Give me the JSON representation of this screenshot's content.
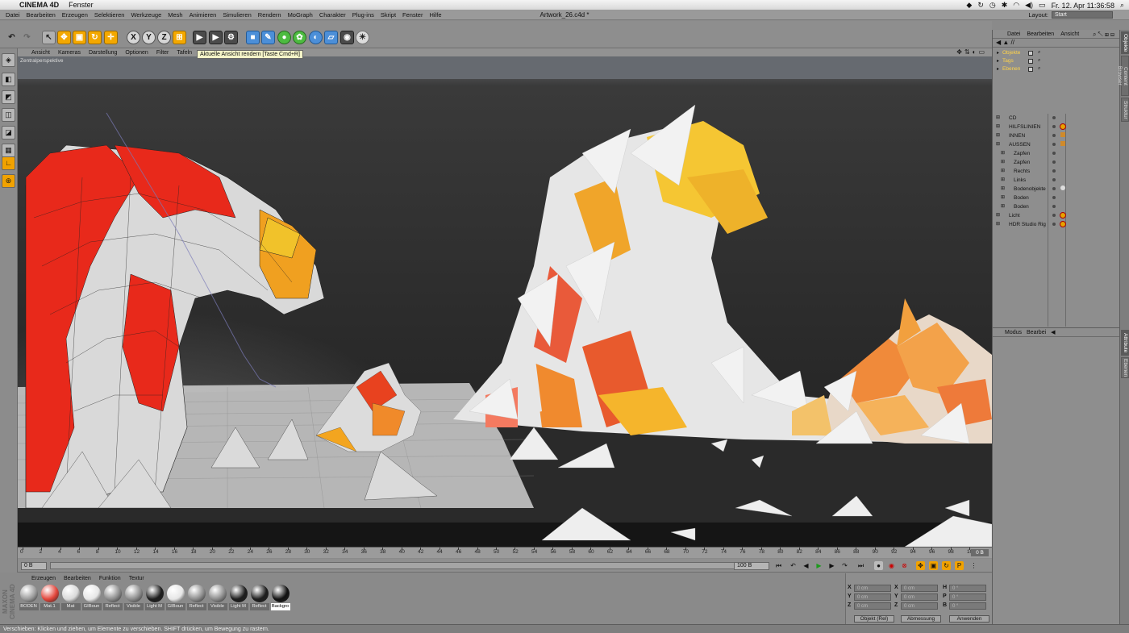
{
  "macbar": {
    "app_name": "CINEMA 4D",
    "menu_fenster": "Fenster",
    "datetime": "Fr. 12. Apr  11:36:58"
  },
  "c4d_menu": {
    "items": [
      "Datei",
      "Bearbeiten",
      "Erzeugen",
      "Selektieren",
      "Werkzeuge",
      "Mesh",
      "Animieren",
      "Simulieren",
      "Rendern",
      "MoGraph",
      "Charakter",
      "Plug-ins",
      "Skript",
      "Fenster",
      "Hilfe"
    ],
    "document_title": "Artwork_26.c4d *",
    "layout_label": "Layout:",
    "layout_value": "Start"
  },
  "toolbar": {
    "axis_x": "X",
    "axis_y": "Y",
    "axis_z": "Z",
    "tooltip": "Aktuelle Ansicht rendern [Taste Cmd+R]"
  },
  "viewport": {
    "menu": [
      "Ansicht",
      "Kameras",
      "Darstellung",
      "Optionen",
      "Filter",
      "Tafeln"
    ],
    "label": "Zentralperspektive"
  },
  "timeline": {
    "ticks": [
      "0",
      "2",
      "4",
      "6",
      "8",
      "10",
      "12",
      "14",
      "16",
      "18",
      "20",
      "22",
      "24",
      "26",
      "28",
      "30",
      "32",
      "34",
      "36",
      "38",
      "40",
      "42",
      "44",
      "46",
      "48",
      "50",
      "52",
      "54",
      "56",
      "58",
      "60",
      "62",
      "64",
      "66",
      "68",
      "70",
      "72",
      "74",
      "76",
      "78",
      "80",
      "82",
      "84",
      "86",
      "88",
      "90",
      "92",
      "94",
      "96",
      "98",
      "100"
    ],
    "current_frame": "0 B",
    "start_field": "0 B",
    "end_field": "100 B"
  },
  "material_manager": {
    "menu": [
      "Erzeugen",
      "Bearbeiten",
      "Funktion",
      "Textur"
    ],
    "materials": [
      {
        "name": "BODEN",
        "color": "#9b9b9b"
      },
      {
        "name": "Mat.1",
        "color": "#e2453a"
      },
      {
        "name": "Mat",
        "color": "#d9d9d9"
      },
      {
        "name": "GIBoun",
        "color": "#e6e6e6"
      },
      {
        "name": "Reflect",
        "color": "#8c8c8c"
      },
      {
        "name": "Visible",
        "color": "#8c8c8c"
      },
      {
        "name": "Light M",
        "color": "#1d1d1d"
      },
      {
        "name": "GIBoun",
        "color": "#e6e6e6"
      },
      {
        "name": "Reflect",
        "color": "#8c8c8c"
      },
      {
        "name": "Visible",
        "color": "#8c8c8c"
      },
      {
        "name": "Light M",
        "color": "#1d1d1d"
      },
      {
        "name": "Reflect",
        "color": "#1d1d1d"
      },
      {
        "name": "Backgro",
        "color": "#111111"
      }
    ]
  },
  "coordinates": {
    "x_label": "X",
    "y_label": "Y",
    "z_label": "Z",
    "h_label": "H",
    "p_label": "P",
    "b_label": "B",
    "field_cm": "0 cm",
    "field_deg": "0 °",
    "mode_object": "Objekt (Rel)",
    "mode_size": "Abmessung",
    "apply_button": "Anwenden"
  },
  "object_manager": {
    "menu": [
      "Datei",
      "Bearbeiten",
      "Ansicht"
    ],
    "top_tree": [
      {
        "name": "Objekte"
      },
      {
        "name": "Tags"
      },
      {
        "name": "Ebenen"
      }
    ],
    "scene": [
      {
        "name": "CD",
        "indent": 0
      },
      {
        "name": "HILFSLINIEN",
        "indent": 0
      },
      {
        "name": "INNEN",
        "indent": 0
      },
      {
        "name": "AUSSEN",
        "indent": 0
      },
      {
        "name": "Zapfen",
        "indent": 1
      },
      {
        "name": "Zapfen",
        "indent": 1
      },
      {
        "name": "Rechts",
        "indent": 1
      },
      {
        "name": "Links",
        "indent": 1
      },
      {
        "name": "Bodenobjekte",
        "indent": 1
      },
      {
        "name": "Boden",
        "indent": 1
      },
      {
        "name": "Boden",
        "indent": 1
      },
      {
        "name": "Licht",
        "indent": 0
      },
      {
        "name": "HDR Studio Rig",
        "indent": 0
      }
    ]
  },
  "attribute_manager": {
    "menu": [
      "Modus",
      "Bearbei"
    ]
  },
  "side_tabs": [
    "Objekte",
    "Content Browser",
    "Struktur",
    "Attribute",
    "Ebenen"
  ],
  "statusbar": {
    "text": "Verschieben: Klicken und ziehen, um Elemente zu verschieben. SHIFT drücken, um Bewegung zu rastern."
  },
  "brand": {
    "maxon": "MAXON",
    "cinema4d": "CINEMA 4D"
  }
}
